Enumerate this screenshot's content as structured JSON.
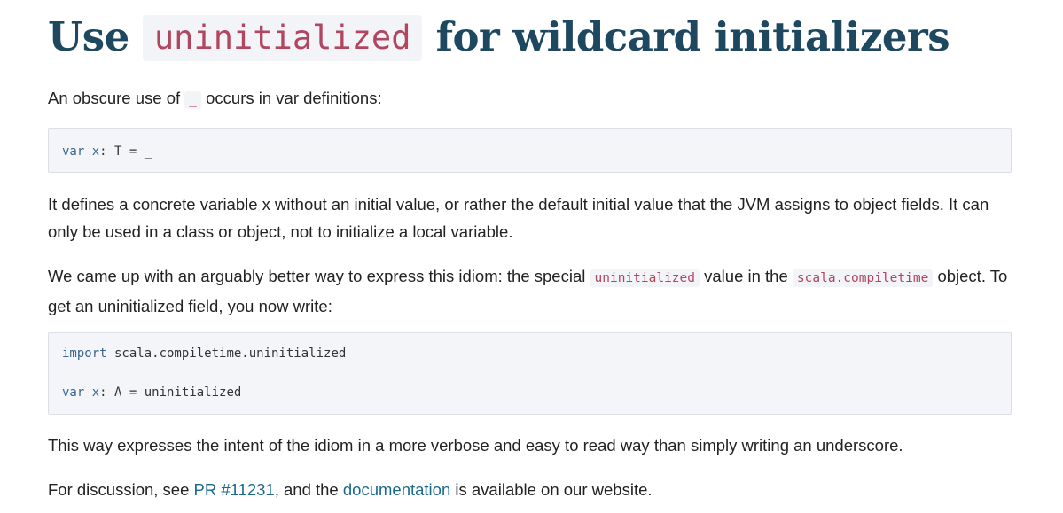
{
  "title": {
    "prefix": "Use",
    "code": "uninitialized",
    "suffix": "for wildcard initializers"
  },
  "para1": {
    "before": "An obscure use of",
    "code": "_",
    "after": "occurs in var definitions:"
  },
  "code_block_1": {
    "kw": "var",
    "ident": "x",
    "rest": ": T = _"
  },
  "para2": {
    "text": "It defines a concrete variable x without an initial value, or rather the default initial value that the JVM assigns to object fields. It can only be used in a class or object, not to initialize a local variable."
  },
  "para3": {
    "part1": "We came up with an arguably better way to express this idiom: the special",
    "code1": "uninitialized",
    "part2": "value in the",
    "code2": "scala.compiletime",
    "part3": "object. To get an uninitialized field, you now write:"
  },
  "code_block_2": {
    "line1_kw": "import",
    "line1_rest": " scala.compiletime.uninitialized",
    "line2_kw": "var",
    "line2_ident": "x",
    "line2_rest": ": A = uninitialized"
  },
  "para4": {
    "text": "This way expresses the intent of the idiom in a more verbose and easy to read way than simply writing an underscore."
  },
  "para5": {
    "before": "For discussion, see",
    "link1": "PR #11231",
    "middle": ", and the",
    "link2": "documentation",
    "after": "is available on our website."
  },
  "colors": {
    "heading": "#1e4760",
    "inline_code": "#b2465f",
    "link": "#1b6a8a",
    "code_bg": "#f4f5f9"
  }
}
